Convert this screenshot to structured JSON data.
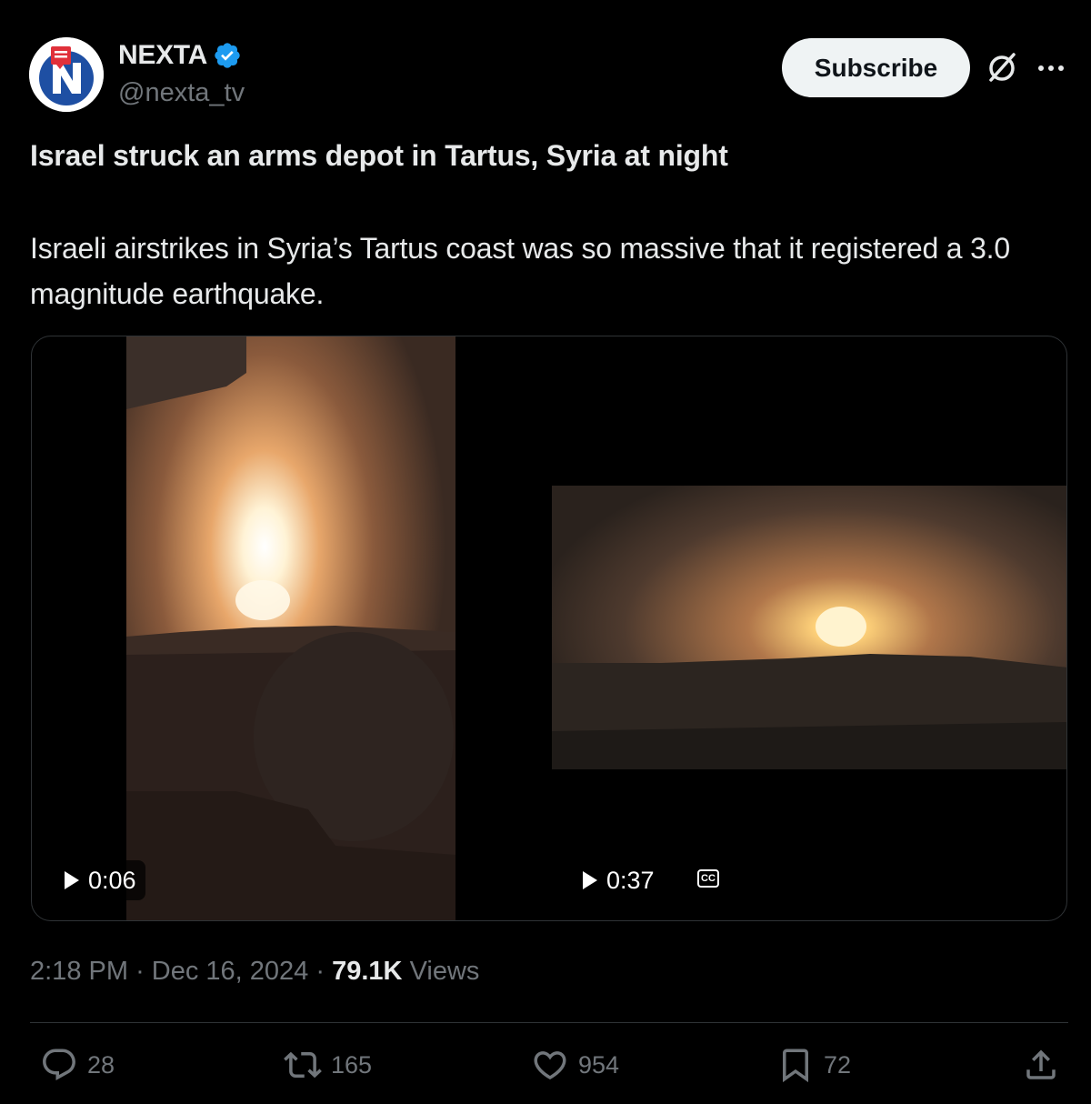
{
  "author": {
    "display_name": "NEXTA",
    "handle": "@nexta_tv",
    "verified": true
  },
  "header": {
    "subscribe_label": "Subscribe",
    "icons": [
      "grok-icon",
      "more-icon"
    ]
  },
  "post": {
    "headline": "Israel struck an arms depot in Tartus, Syria at night",
    "body": "Israeli airstrikes in Syria’s Tartus coast was so massive that it registered a 3.0 magnitude earthquake."
  },
  "media": {
    "videos": [
      {
        "duration": "0:06"
      },
      {
        "duration": "0:37",
        "captions_icon": "CC"
      }
    ]
  },
  "meta": {
    "time": "2:18 PM",
    "separator": "·",
    "date": "Dec 16, 2024",
    "views_count": "79.1K",
    "views_label": "Views"
  },
  "actions": {
    "replies": "28",
    "reposts": "165",
    "likes": "954",
    "bookmarks": "72"
  },
  "colors": {
    "background": "#000000",
    "text_primary": "#e7e9ea",
    "text_secondary": "#71767b",
    "border": "#2f3336",
    "verified_blue": "#1d9bf0",
    "subscribe_bg": "#eff3f4"
  }
}
